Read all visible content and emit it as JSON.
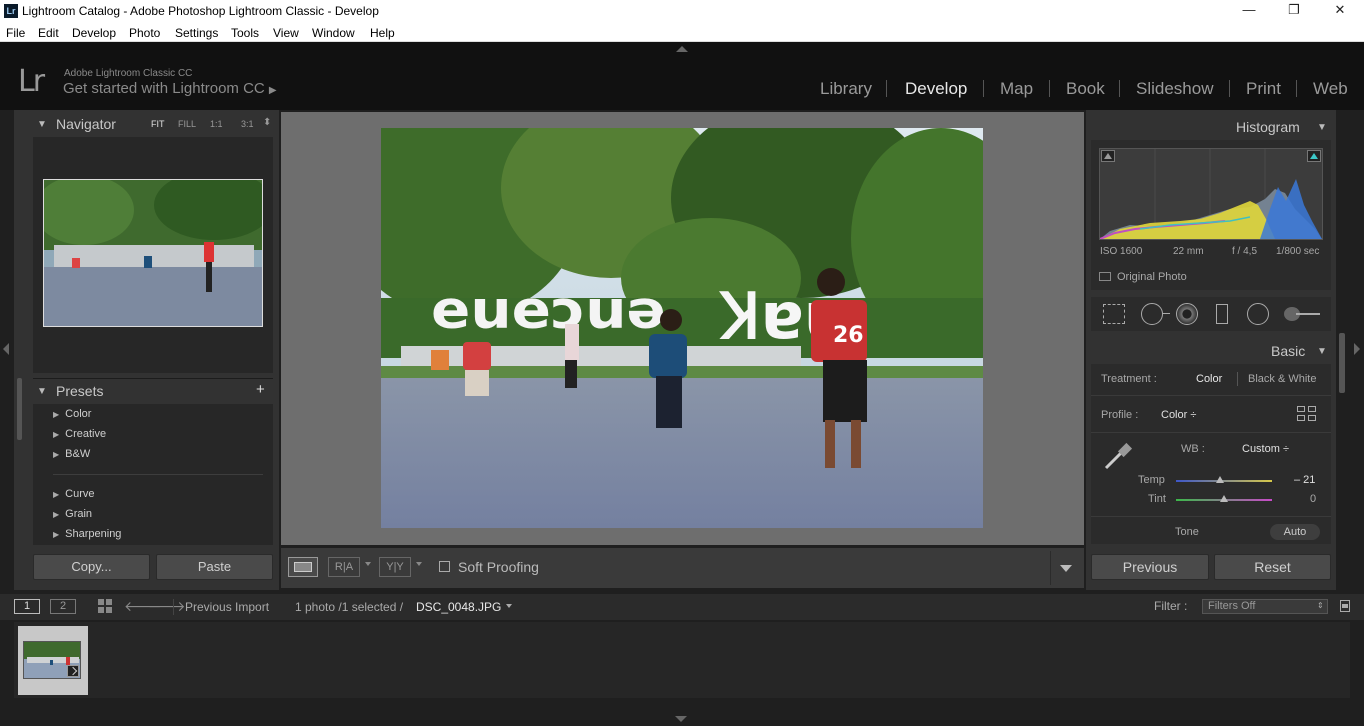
{
  "window": {
    "title": "Lightroom Catalog - Adobe Photoshop Lightroom Classic - Develop",
    "app_icon": "Lr",
    "min": "—",
    "max": "❐",
    "close": "✕"
  },
  "menu": [
    "File",
    "Edit",
    "Develop",
    "Photo",
    "Settings",
    "Tools",
    "View",
    "Window",
    "Help"
  ],
  "identity": {
    "logo": "Lr",
    "line1": "Adobe Lightroom Classic CC",
    "line2": "Get started with Lightroom CC",
    "arrow": "▶"
  },
  "modules": [
    "Library",
    "Develop",
    "Map",
    "Book",
    "Slideshow",
    "Print",
    "Web"
  ],
  "active_module": "Develop",
  "navigator": {
    "title": "Navigator",
    "zoom": [
      "FIT",
      "FILL",
      "1:1",
      "3:1"
    ],
    "zoom_more": "⬍"
  },
  "presets": {
    "title": "Presets",
    "add": "+",
    "groups1": [
      "Color",
      "Creative",
      "B&W"
    ],
    "groups2": [
      "Curve",
      "Grain",
      "Sharpening"
    ]
  },
  "left_buttons": {
    "copy": "Copy...",
    "paste": "Paste"
  },
  "toolbar": {
    "soft_proofing": "Soft Proofing",
    "ra": "R|A",
    "yy": "Y|Y"
  },
  "histogram": {
    "title": "Histogram",
    "iso": "ISO 1600",
    "focal": "22 mm",
    "aperture": "f / 4,5",
    "shutter": "1/800 sec",
    "original_photo": "Original Photo"
  },
  "basic": {
    "title": "Basic",
    "treatment_label": "Treatment :",
    "treatment_color": "Color",
    "treatment_bw": "Black & White",
    "profile_label": "Profile :",
    "profile_value": "Color ÷",
    "wb_label": "WB :",
    "wb_value": "Custom ÷",
    "temp_label": "Temp",
    "temp_value": "– 21",
    "temp_position": 0.46,
    "tint_label": "Tint",
    "tint_value": "0",
    "tint_position": 0.5,
    "tone_label": "Tone",
    "auto": "Auto"
  },
  "right_buttons": {
    "previous": "Previous",
    "reset": "Reset"
  },
  "filmbar": {
    "view1": "1",
    "view2": "2",
    "source": "Previous Import",
    "count": "1 photo /1 selected /",
    "filename": "DSC_0048.JPG",
    "filter_label": "Filter :",
    "filter_value": "Filters Off"
  },
  "colors": {
    "bg": "#1f1f1f",
    "panel": "#323232",
    "center": "#6e6e6e",
    "accent": "#e8e8e8"
  }
}
